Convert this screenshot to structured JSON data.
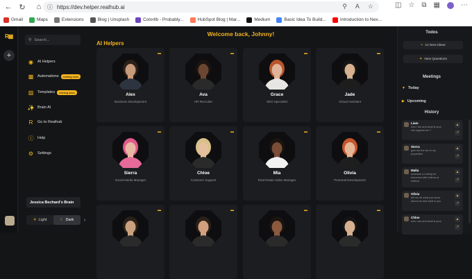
{
  "browser": {
    "url": "https://dev.helper.realhub.ai",
    "bookmarks": [
      {
        "label": "Gmail",
        "icon": "gmail-icon",
        "color": "#d93025"
      },
      {
        "label": "Maps",
        "icon": "maps-icon",
        "color": "#34a853"
      },
      {
        "label": "Extensions",
        "icon": "extensions-icon",
        "color": "#777777"
      },
      {
        "label": "Blog | Unsplash",
        "icon": "unsplash-icon",
        "color": "#555555"
      },
      {
        "label": "Colorlib - Probably...",
        "icon": "colorlib-icon",
        "color": "#6b46c1"
      },
      {
        "label": "HubSpot Blog | Mar...",
        "icon": "hubspot-icon",
        "color": "#ff7a59"
      },
      {
        "label": "Medium",
        "icon": "medium-icon",
        "color": "#111111"
      },
      {
        "label": "Basic Idea To Build...",
        "icon": "google-icon",
        "color": "#4285f4"
      },
      {
        "label": "Introduction to Nex...",
        "icon": "youtube-icon",
        "color": "#ff0000"
      }
    ]
  },
  "sidebar": {
    "search_placeholder": "Search...",
    "items": [
      {
        "label": "AI Helpers",
        "icon": "ai-helpers-icon",
        "badge": ""
      },
      {
        "label": "Automations",
        "icon": "automations-icon",
        "badge": "coming soon"
      },
      {
        "label": "Templates",
        "icon": "templates-icon",
        "badge": "coming soon"
      },
      {
        "label": "Brain AI",
        "icon": "brain-ai-icon",
        "badge": ""
      },
      {
        "label": "Go to Realhub",
        "icon": "realhub-icon",
        "badge": ""
      },
      {
        "label": "Help",
        "icon": "help-icon",
        "badge": ""
      },
      {
        "label": "Settings",
        "icon": "settings-icon",
        "badge": ""
      }
    ],
    "brain_label": "Jessica Bechard's Brain",
    "theme": {
      "light": "Light",
      "dark": "Dark",
      "selected": "Dark"
    }
  },
  "main": {
    "welcome": "Welcome back, Johnny!",
    "section_title": "AI Helpers",
    "helpers": [
      {
        "name": "Alex",
        "role": "Business Development",
        "skin": "#c79a7a",
        "hair": "#2b2118",
        "outfit": "#2c3440"
      },
      {
        "name": "Ava",
        "role": "HR Recruiter",
        "skin": "#6b4630",
        "hair": "#1b1410",
        "outfit": "#2a2a2a"
      },
      {
        "name": "Grace",
        "role": "SEO Specialist",
        "skin": "#e0b49a",
        "hair": "#b8552c",
        "outfit": "#e8e6e3"
      },
      {
        "name": "Jade",
        "role": "Virtual Assistant",
        "skin": "#d6b08f",
        "hair": "#151515",
        "outfit": "#1d1d1d"
      },
      {
        "name": "Sierra",
        "role": "Social Media Manager",
        "skin": "#e8b9a2",
        "hair": "#e05a8c",
        "outfit": "#e56a9a"
      },
      {
        "name": "Chloe",
        "role": "Customer Support",
        "skin": "#e4c09c",
        "hair": "#d8c08a",
        "outfit": "#2a2a2a"
      },
      {
        "name": "Mia",
        "role": "Real Estate Sales Manager",
        "skin": "#7a4d36",
        "hair": "#1b1410",
        "outfit": "#f2f2f2"
      },
      {
        "name": "Olivia",
        "role": "Personal Development",
        "skin": "#e4b696",
        "hair": "#c5552c",
        "outfit": "#1e1e1e"
      },
      {
        "name": "",
        "role": "",
        "skin": "#caa07e",
        "hair": "#2b2118",
        "outfit": "#2a2a2a"
      },
      {
        "name": "",
        "role": "",
        "skin": "#d2a07e",
        "hair": "#2b2118",
        "outfit": "#2a2a2a"
      },
      {
        "name": "",
        "role": "",
        "skin": "#8a5a3e",
        "hair": "#1b1410",
        "outfit": "#2a2a2a"
      },
      {
        "name": "",
        "role": "",
        "skin": "#d6b08f",
        "hair": "#151515",
        "outfit": "#2a2a2a"
      }
    ]
  },
  "right_panel": {
    "todos_title": "Todos",
    "new_ideas": "12 New Ideas",
    "new_questions": "New Questions",
    "meetings_title": "Meetings",
    "today": "Today",
    "upcoming": "Upcoming",
    "history_title": "History",
    "history": [
      {
        "name": "Liam",
        "message": "who i am and what is your role against me ?"
      },
      {
        "name": "Sierra",
        "message": "give me the list of my properties"
      },
      {
        "name": "Malia",
        "message": "schedule a meting for tomorrow with milena at mittens"
      },
      {
        "name": "Olivia",
        "message": "tell me all what you know about me and what is you"
      },
      {
        "name": "Chloe",
        "message": "who i am and what is your"
      }
    ]
  }
}
